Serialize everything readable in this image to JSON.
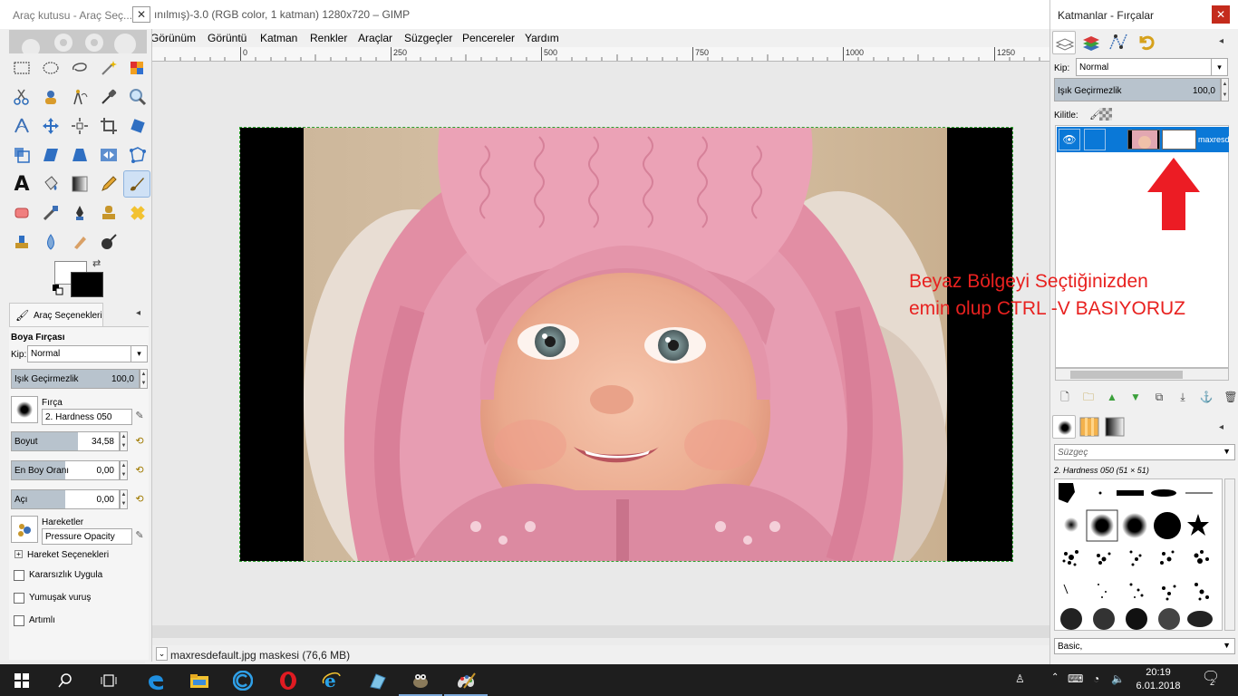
{
  "main_window": {
    "title": "ınılmış)-3.0 (RGB color, 1 katman) 1280x720 – GIMP",
    "menu": [
      "Görünüm",
      "Görüntü",
      "Katman",
      "Renkler",
      "Araçlar",
      "Süzgeçler",
      "Pencereler",
      "Yardım"
    ],
    "ruler_labels": [
      "0",
      "250",
      "500",
      "750",
      "1000",
      "1250"
    ],
    "status_text": "maxresdefault.jpg maskesi (76,6 MB)"
  },
  "toolbox": {
    "title": "Araç kutusu - Araç Seç...",
    "close": "✕",
    "tools": [
      "rect-select",
      "ellipse-select",
      "free-select",
      "fuzzy-select",
      "select-by-color",
      "scissors",
      "foreground-select",
      "paths",
      "color-picker",
      "zoom",
      "measure",
      "move",
      "align",
      "crop",
      "rotate",
      "scale",
      "shear",
      "perspective",
      "flip",
      "cage",
      "text",
      "bucket-fill",
      "blend",
      "pencil",
      "paintbrush",
      "eraser",
      "airbrush",
      "ink",
      "clone",
      "heal",
      "perspective-clone",
      "blur",
      "smudge",
      "dodge-burn"
    ],
    "active_tool": "paintbrush",
    "colors": {
      "foreground": "#ffffff",
      "background": "#000000"
    }
  },
  "tool_options": {
    "tab_label": "Araç Seçenekleri",
    "heading": "Boya Fırçası",
    "mode_label": "Kip:",
    "mode_value": "Normal",
    "opacity_label": "Işık Geçirmezlik",
    "opacity_value": "100,0",
    "opacity_fraction": 1.0,
    "brush_label": "Fırça",
    "brush_value": "2. Hardness 050",
    "size_label": "Boyut",
    "size_value": "34,58",
    "size_fraction": 0.62,
    "aspect_label": "En Boy Oranı",
    "aspect_value": "0,00",
    "aspect_fraction": 0.5,
    "angle_label": "Açı",
    "angle_value": "0,00",
    "angle_fraction": 0.5,
    "dynamics_label": "Hareketler",
    "dynamics_value": "Pressure Opacity",
    "dynamics_options_label": "Hareket Seçenekleri",
    "jitter_label": "Kararsızlık Uygula",
    "smooth_label": "Yumuşak vuruş",
    "incremental_label": "Artımlı"
  },
  "dock": {
    "title": "Katmanlar - Fırçalar",
    "close": "✕",
    "mode_label": "Kip:",
    "mode_value": "Normal",
    "opacity_label": "Işık Geçirmezlik",
    "opacity_value": "100,0",
    "opacity_fraction": 1.0,
    "lock_label": "Kilitle:",
    "layer_name": "maxresdefault.jpg",
    "filter_placeholder": "Süzgeç",
    "brush_name": "2. Hardness 050 (51 × 51)",
    "brush_set": "Basic,"
  },
  "annotation": {
    "line1": "Beyaz Bölgeyi Seçtiğinizden",
    "line2": "emin olup CTRL -V BASIYORUZ",
    "color": "#e8211f"
  },
  "taskbar": {
    "time": "20:19",
    "date": "6.01.2018",
    "notifications": "2"
  }
}
